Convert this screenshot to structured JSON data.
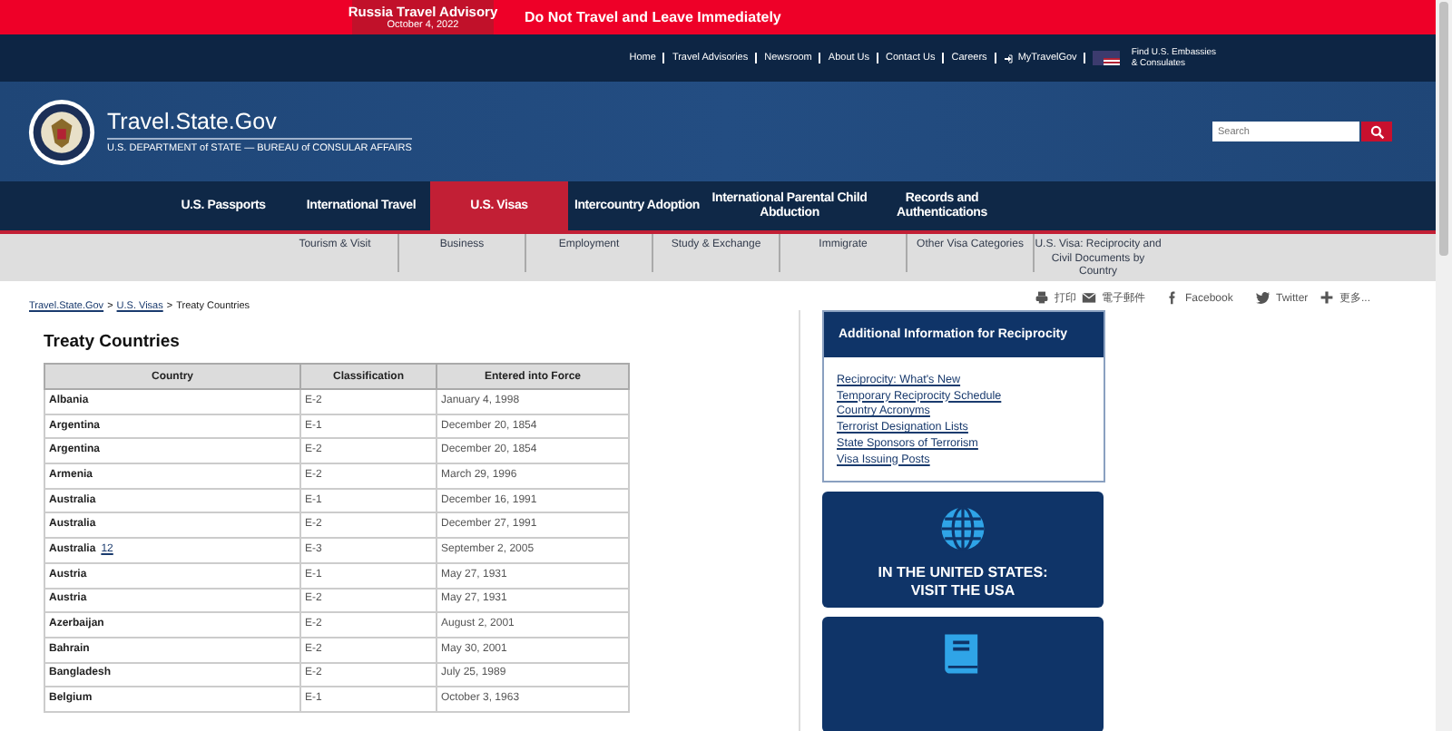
{
  "alert": {
    "title": "Russia Travel Advisory",
    "date": "October 4, 2022",
    "message": "Do Not Travel and Leave Immediately"
  },
  "top_links": [
    "Home",
    "Travel Advisories",
    "Newsroom",
    "About Us",
    "Contact Us",
    "Careers",
    "MyTravelGov"
  ],
  "embassy_link": [
    "Find U.S. Embassies",
    "& Consulates"
  ],
  "site": {
    "name": "Travel.State.Gov",
    "subtitle": "U.S. DEPARTMENT of STATE — BUREAU of CONSULAR AFFAIRS"
  },
  "search": {
    "placeholder": "Search"
  },
  "main_nav": [
    {
      "label": "U.S. Passports",
      "selected": false
    },
    {
      "label": "International Travel",
      "selected": false
    },
    {
      "label": "U.S. Visas",
      "selected": true
    },
    {
      "label": "Intercountry Adoption",
      "selected": false
    },
    {
      "label": "International Parental Child Abduction",
      "selected": false
    },
    {
      "label": "Records and Authentications",
      "selected": false
    }
  ],
  "sub_nav": [
    "Tourism & Visit",
    "Business",
    "Employment",
    "Study & Exchange",
    "Immigrate",
    "Other Visa Categories",
    "U.S. Visa: Reciprocity and Civil Documents by Country"
  ],
  "breadcrumb": {
    "links": [
      "Travel.State.Gov",
      "U.S. Visas"
    ],
    "separator": ">",
    "current": "Treaty Countries"
  },
  "share": [
    {
      "kind": "print",
      "label": "打印"
    },
    {
      "kind": "email",
      "label": "電子郵件"
    },
    {
      "kind": "facebook",
      "label": "Facebook"
    },
    {
      "kind": "twitter",
      "label": "Twitter"
    },
    {
      "kind": "more",
      "label": "更多..."
    }
  ],
  "page_title": "Treaty Countries",
  "table": {
    "columns": [
      "Country",
      "Classification",
      "Entered into Force"
    ],
    "rows": [
      {
        "country": "Albania",
        "classification": "E-2",
        "date": "January 4, 1998"
      },
      {
        "country": "Argentina",
        "classification": "E-1",
        "date": "December 20, 1854"
      },
      {
        "country": "Argentina",
        "classification": "E-2",
        "date": "December 20, 1854"
      },
      {
        "country": "Armenia",
        "classification": "E-2",
        "date": "March 29, 1996"
      },
      {
        "country": "Australia",
        "classification": "E-1",
        "date": "December 16, 1991"
      },
      {
        "country": "Australia",
        "classification": "E-2",
        "date": "December 27, 1991"
      },
      {
        "country": "Australia",
        "note": "12",
        "classification": "E-3",
        "date": "September 2, 2005"
      },
      {
        "country": "Austria",
        "classification": "E-1",
        "date": "May 27, 1931"
      },
      {
        "country": "Austria",
        "classification": "E-2",
        "date": "May 27, 1931"
      },
      {
        "country": "Azerbaijan",
        "classification": "E-2",
        "date": "August 2, 2001"
      },
      {
        "country": "Bahrain",
        "classification": "E-2",
        "date": "May 30, 2001"
      },
      {
        "country": "Bangladesh",
        "classification": "E-2",
        "date": "July 25, 1989"
      },
      {
        "country": "Belgium",
        "classification": "E-1",
        "date": "October 3, 1963"
      }
    ]
  },
  "sidebar": {
    "info_title": "Additional Information for Reciprocity",
    "info_links": [
      "Reciprocity: What's New",
      "Temporary Reciprocity Schedule",
      "Country Acronyms",
      "Terrorist Designation Lists",
      "State Sponsors of Terrorism",
      "Visa Issuing Posts"
    ],
    "cards": [
      {
        "kind": "globe",
        "title": [
          "IN THE UNITED STATES:",
          "VISIT THE USA"
        ]
      },
      {
        "kind": "book"
      }
    ]
  }
}
